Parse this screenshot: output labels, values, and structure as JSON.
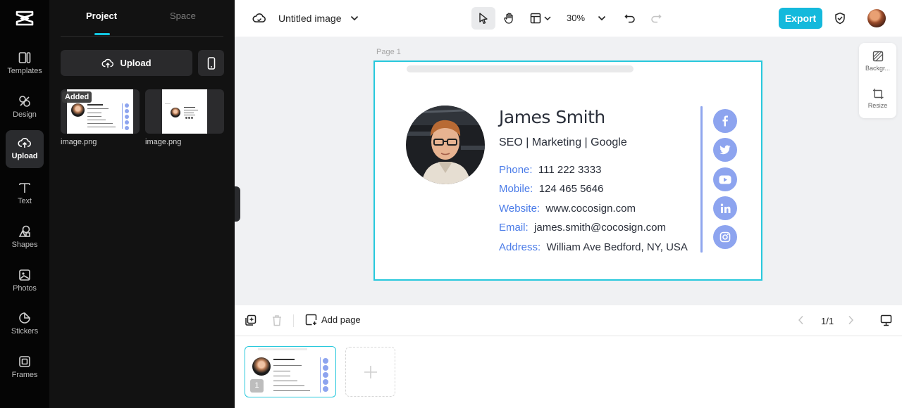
{
  "app": {
    "title": "Untitled image"
  },
  "rail": {
    "items": [
      {
        "label": "Templates",
        "icon": "templates-icon"
      },
      {
        "label": "Design",
        "icon": "design-icon"
      },
      {
        "label": "Upload",
        "icon": "upload-cloud-icon"
      },
      {
        "label": "Text",
        "icon": "text-icon"
      },
      {
        "label": "Shapes",
        "icon": "shapes-icon"
      },
      {
        "label": "Photos",
        "icon": "photos-icon"
      },
      {
        "label": "Stickers",
        "icon": "stickers-icon"
      },
      {
        "label": "Frames",
        "icon": "frames-icon"
      }
    ],
    "active": "Upload"
  },
  "panel": {
    "tabs": [
      "Project",
      "Space"
    ],
    "upload_label": "Upload",
    "added_badge": "Added",
    "files": [
      {
        "name": "image.png"
      },
      {
        "name": "image.png"
      }
    ]
  },
  "toolbar": {
    "zoom": "30%",
    "export_label": "Export"
  },
  "canvas": {
    "page_label": "Page 1",
    "signature": {
      "name": "James Smith",
      "role": "SEO | Marketing | Google",
      "rows": [
        {
          "label": "Phone:",
          "value": "111 222 3333"
        },
        {
          "label": "Mobile:",
          "value": "124 465 5646"
        },
        {
          "label": "Website:",
          "value": "www.cocosign.com"
        },
        {
          "label": "Email:",
          "value": "james.smith@cocosign.com"
        },
        {
          "label": "Address:",
          "value": "William Ave Bedford, NY, USA"
        }
      ],
      "social": [
        "facebook-icon",
        "twitter-icon",
        "youtube-icon",
        "linkedin-icon",
        "instagram-icon"
      ],
      "accent_color": "#4a7be8",
      "social_color": "#8da4ef"
    }
  },
  "side_tools": [
    {
      "label": "Backgr...",
      "icon": "background-icon"
    },
    {
      "label": "Resize",
      "icon": "resize-icon"
    }
  ],
  "pagebar": {
    "add_page_label": "Add page",
    "page_count": "1/1"
  },
  "filmstrip": {
    "page_number": "1"
  },
  "colors": {
    "brand": "#14b9dc",
    "selection": "#27c8dc"
  }
}
